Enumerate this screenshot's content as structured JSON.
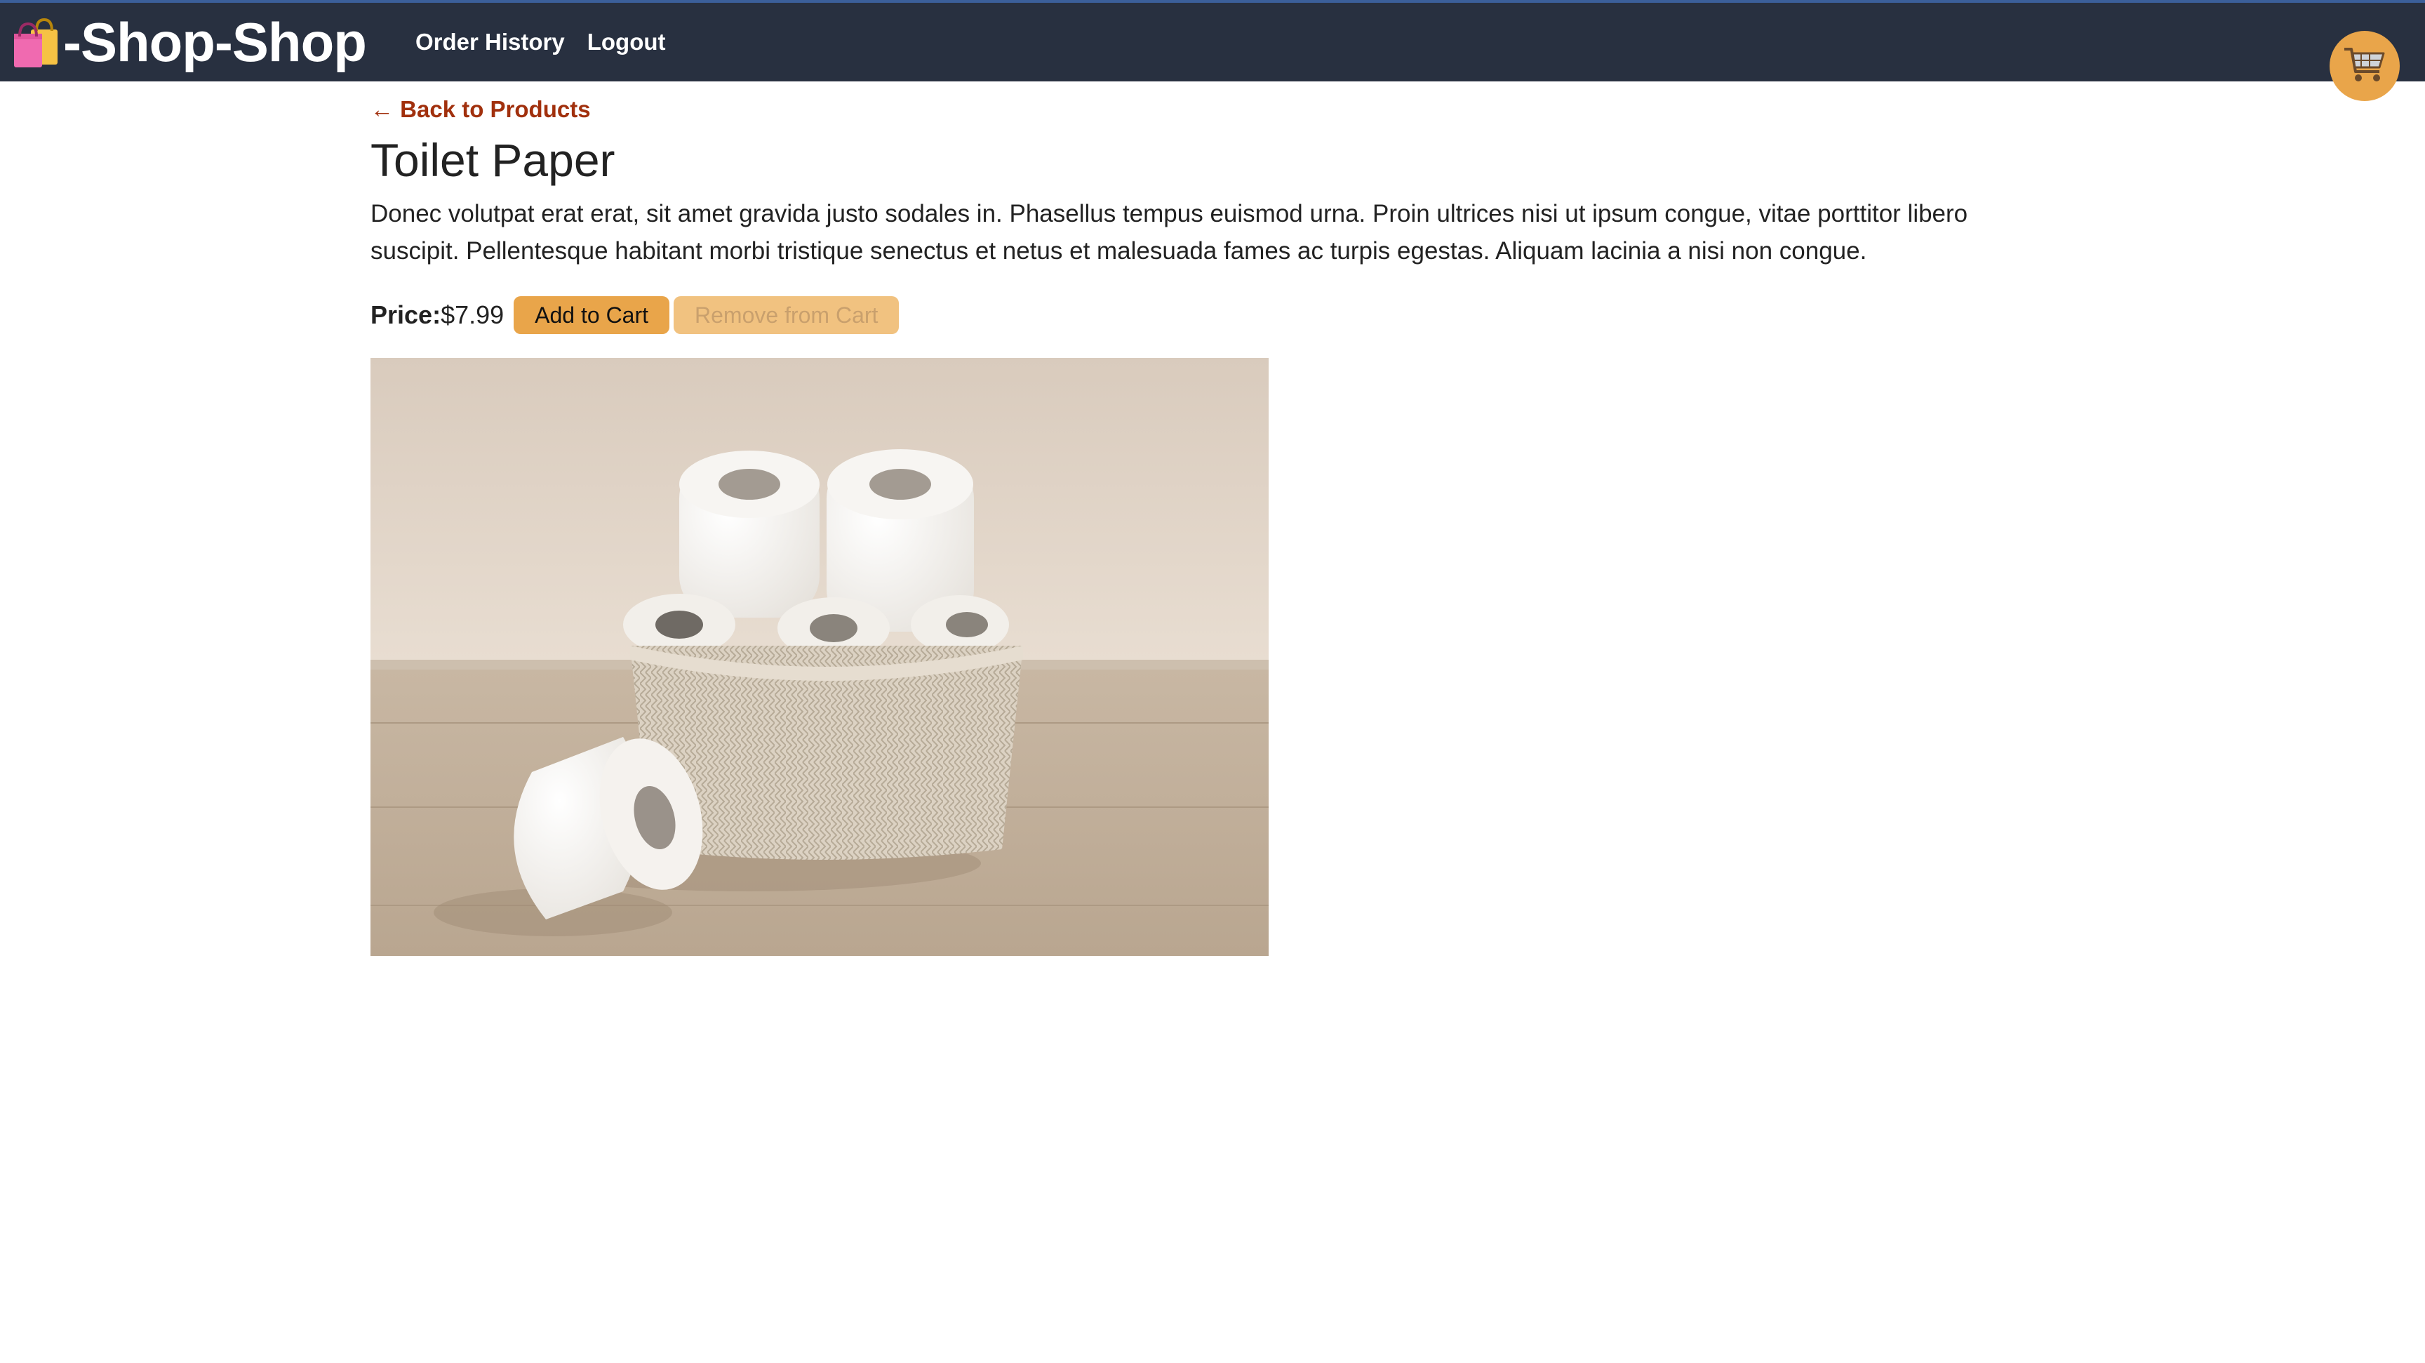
{
  "header": {
    "brand_text": "-Shop-Shop",
    "brand_icon": "shopping-bags-icon",
    "nav": [
      {
        "label": "Order History"
      },
      {
        "label": "Logout"
      }
    ],
    "cart_icon": "shopping-cart-icon"
  },
  "product": {
    "back_link": "← Back to Products",
    "title": "Toilet Paper",
    "description": "Donec volutpat erat erat, sit amet gravida justo sodales in. Phasellus tempus euismod urna. Proin ultrices nisi ut ipsum congue, vitae porttitor libero suscipit. Pellentesque habitant morbi tristique senectus et netus et malesuada fames ac turpis egestas. Aliquam lacinia a nisi non congue.",
    "price_label": "Price:",
    "price_value": "$7.99",
    "add_button": "Add to Cart",
    "remove_button": "Remove from Cart",
    "image_icon": "toilet-paper-basket-photo"
  },
  "colors": {
    "navbar": "#283040",
    "accent": "#e9a54a",
    "link": "#a1300d"
  }
}
